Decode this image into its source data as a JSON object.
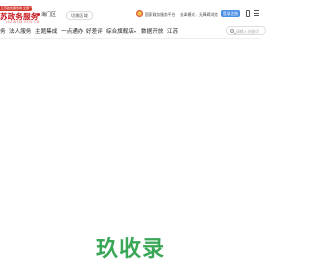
{
  "header": {
    "tag_text": "江苏政务服务网 全国一体化政务服务平台",
    "logo_text": "苏政务服务",
    "logo_sub": "JSZWFW.GOV.CN",
    "location": "海门区",
    "switch_region": "切换区域",
    "gov_portal": "国家政务服务平台",
    "elder_mode": "长辈模式",
    "separator": "|",
    "accessible": "无障碍浏览",
    "login": "登录注册"
  },
  "nav": {
    "items": [
      {
        "label": "务"
      },
      {
        "label": "法人服务"
      },
      {
        "label": "主题集成"
      },
      {
        "label": "一点通办"
      },
      {
        "label": "好差评"
      },
      {
        "label": "综合旗舰店",
        "caret": "▾"
      },
      {
        "label": "数据开放"
      },
      {
        "label": "江苏"
      }
    ],
    "search_placeholder": "请输入关键词"
  },
  "footer": {
    "brand": "玖收录"
  },
  "colors": {
    "brand_red": "#c8161d",
    "accent_blue": "#4a8fe7",
    "watermark_green": "#3aa757"
  }
}
